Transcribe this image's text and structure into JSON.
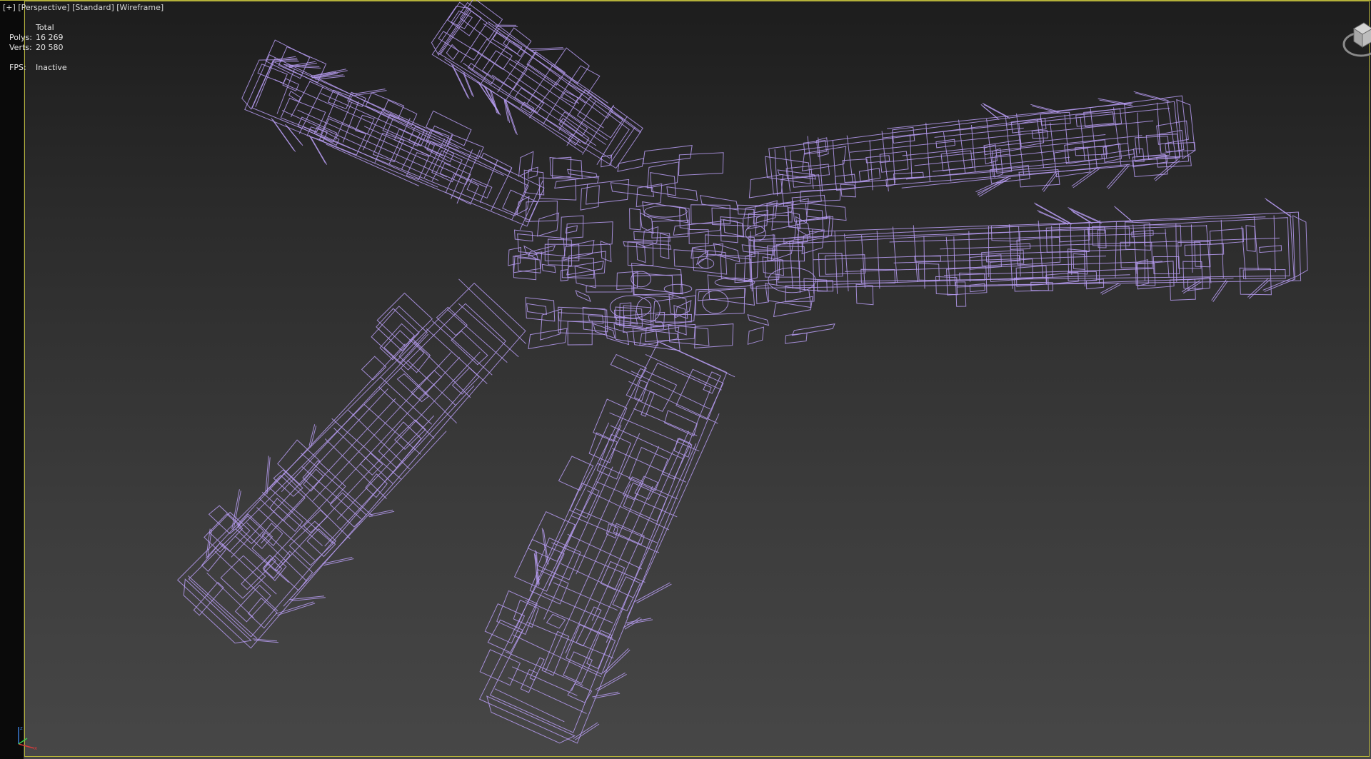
{
  "viewport": {
    "label": {
      "plus": "[+]",
      "view": "[Perspective]",
      "shading_preset": "[Standard]",
      "render_mode": "[Wireframe]"
    },
    "stats": {
      "header": "Total",
      "polys_label": "Polys:",
      "polys_value": "16 269",
      "verts_label": "Verts:",
      "verts_value": "20 580",
      "fps_label": "FPS:",
      "fps_value": "Inactive"
    }
  },
  "colors": {
    "wireframe": "#b79cf2",
    "active_viewport_border": "#b5b23a",
    "background_top": "#1d1d1d",
    "background_bottom": "#474747"
  },
  "icons": {
    "viewcube": "viewcube-icon",
    "axis_tripod": "axis-tripod-icon"
  }
}
